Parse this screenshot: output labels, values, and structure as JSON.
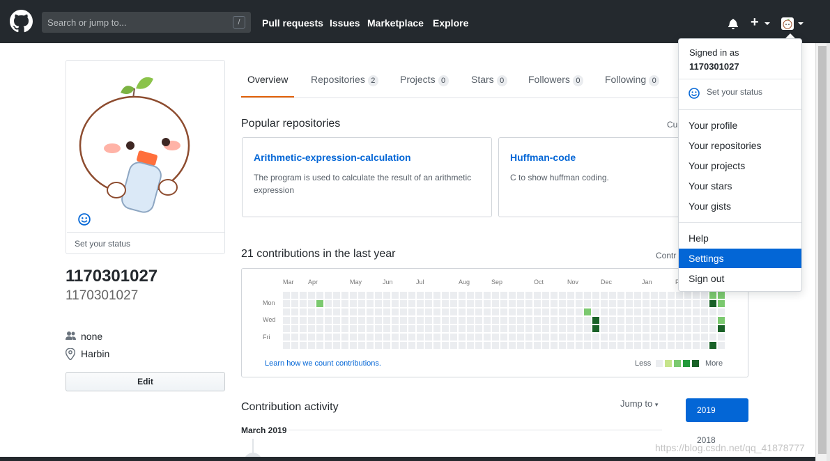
{
  "header": {
    "search_placeholder": "Search or jump to...",
    "search_shortcut": "/",
    "nav": [
      "Pull requests",
      "Issues",
      "Marketplace",
      "Explore"
    ],
    "plus_label": "+"
  },
  "profile": {
    "set_status": "Set your status",
    "name": "1170301027",
    "login": "1170301027",
    "company": "none",
    "location": "Harbin",
    "edit_label": "Edit"
  },
  "tabs": [
    {
      "label": "Overview",
      "count": ""
    },
    {
      "label": "Repositories",
      "count": "2"
    },
    {
      "label": "Projects",
      "count": "0"
    },
    {
      "label": "Stars",
      "count": "0"
    },
    {
      "label": "Followers",
      "count": "0"
    },
    {
      "label": "Following",
      "count": "0"
    }
  ],
  "popular": {
    "heading": "Popular repositories",
    "customize_cut": "Cu",
    "repos": [
      {
        "name": "Arithmetic-expression-calculation",
        "desc": "The program is used to calculate the result of an arithmetic expression"
      },
      {
        "name": "Huffman-code",
        "desc": "C to show huffman coding."
      }
    ]
  },
  "contributions": {
    "heading": "21 contributions in the last year",
    "settings_cut": "Contr",
    "months": [
      "Mar",
      "Apr",
      "May",
      "Jun",
      "Jul",
      "Aug",
      "Sep",
      "Oct",
      "Nov",
      "Dec",
      "Jan",
      "F"
    ],
    "days": [
      "Mon",
      "Wed",
      "Fri"
    ],
    "learn_link": "Learn how we count contributions.",
    "less": "Less",
    "more": "More",
    "colors": [
      "#ebedf0",
      "#c6e48b",
      "#7bc96f",
      "#239a3b",
      "#196127"
    ],
    "active_cells": [
      {
        "week": 4,
        "day": 1,
        "level": 2
      },
      {
        "week": 36,
        "day": 2,
        "level": 2
      },
      {
        "week": 37,
        "day": 3,
        "level": 4
      },
      {
        "week": 37,
        "day": 4,
        "level": 4
      },
      {
        "week": 51,
        "day": 0,
        "level": 2
      },
      {
        "week": 51,
        "day": 1,
        "level": 4
      },
      {
        "week": 52,
        "day": 0,
        "level": 2
      },
      {
        "week": 52,
        "day": 1,
        "level": 2
      },
      {
        "week": 52,
        "day": 3,
        "level": 2
      },
      {
        "week": 52,
        "day": 4,
        "level": 4
      },
      {
        "week": 51,
        "day": 6,
        "level": 4
      }
    ]
  },
  "activity": {
    "heading": "Contribution activity",
    "jump_to": "Jump to",
    "month_heading": "March 2019",
    "years": [
      "2019",
      "2018"
    ]
  },
  "dropdown": {
    "signed_in_as": "Signed in as",
    "username": "1170301027",
    "set_status": "Set your status",
    "group1": [
      "Your profile",
      "Your repositories",
      "Your projects",
      "Your stars",
      "Your gists"
    ],
    "group2": [
      "Help",
      "Settings",
      "Sign out"
    ],
    "highlighted": "Settings"
  },
  "watermark": "https://blog.csdn.net/qq_41878777"
}
